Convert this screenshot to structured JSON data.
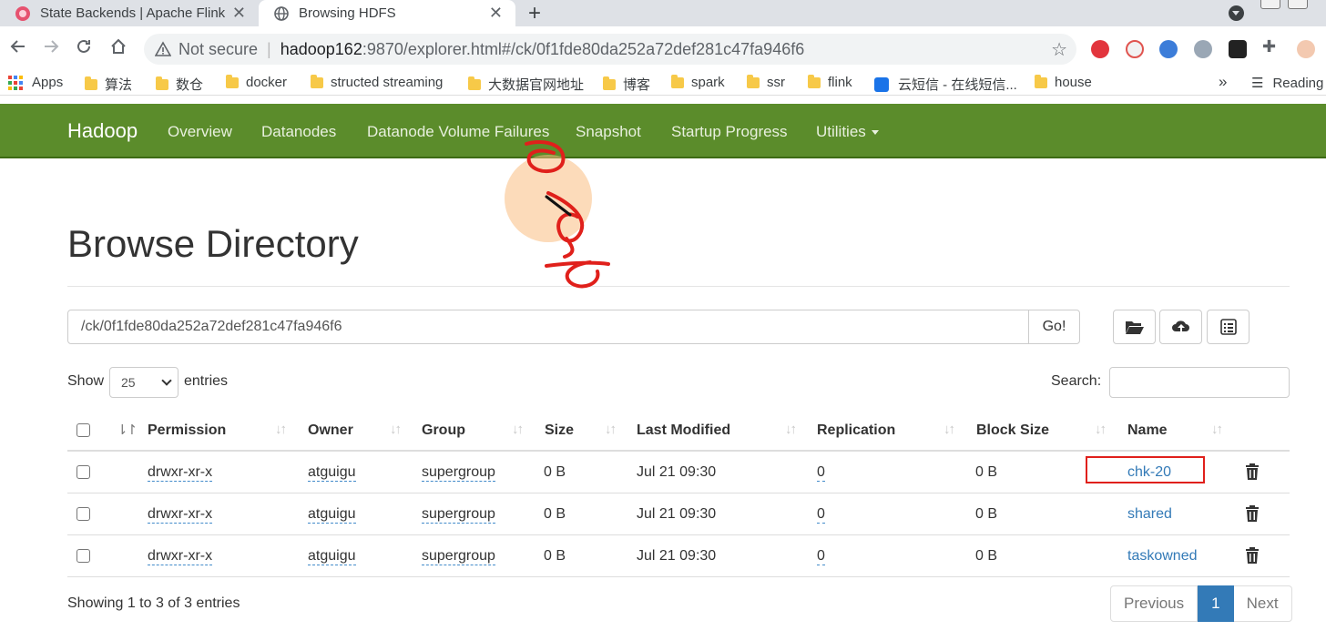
{
  "browser": {
    "tabs": [
      {
        "title": "State Backends | Apache Flink",
        "active": false
      },
      {
        "title": "Browsing HDFS",
        "active": true
      }
    ],
    "new_tab": "+",
    "close_glyph": "✕",
    "address": {
      "security": "Not secure",
      "host": "hadoop162",
      "path": ":9870/explorer.html#/ck/0f1fde80da252a72def281c47fa946f6"
    },
    "bookmarks": [
      {
        "label": "Apps",
        "icon": "apps-grid-icon"
      },
      {
        "label": "算法",
        "icon": "folder-icon"
      },
      {
        "label": "数仓",
        "icon": "folder-icon"
      },
      {
        "label": "docker",
        "icon": "folder-icon"
      },
      {
        "label": "structed streaming",
        "icon": "folder-icon"
      },
      {
        "label": "大数据官网地址",
        "icon": "folder-icon"
      },
      {
        "label": "博客",
        "icon": "folder-icon"
      },
      {
        "label": "spark",
        "icon": "folder-icon"
      },
      {
        "label": "ssr",
        "icon": "folder-icon"
      },
      {
        "label": "flink",
        "icon": "folder-icon"
      },
      {
        "label": "云短信 - 在线短信...",
        "icon": "cloud-sms-icon"
      },
      {
        "label": "house",
        "icon": "folder-icon"
      }
    ],
    "more_bookmarks": "»",
    "reading_list": "Reading"
  },
  "navbar": {
    "brand": "Hadoop",
    "links": [
      "Overview",
      "Datanodes",
      "Datanode Volume Failures",
      "Snapshot",
      "Startup Progress",
      "Utilities"
    ],
    "color": "#5b8c2b"
  },
  "page": {
    "title": "Browse Directory",
    "path_value": "/ck/0f1fde80da252a72def281c47fa946f6",
    "go_label": "Go!",
    "show_label": "Show",
    "entries_value": "25",
    "entries_label": "entries",
    "search_label": "Search:",
    "columns": [
      "Permission",
      "Owner",
      "Group",
      "Size",
      "Last Modified",
      "Replication",
      "Block Size",
      "Name"
    ],
    "rows": [
      {
        "permission": "drwxr-xr-x",
        "owner": "atguigu",
        "group": "supergroup",
        "size": "0 B",
        "modified": "Jul 21 09:30",
        "replication": "0",
        "block_size": "0 B",
        "name": "chk-20"
      },
      {
        "permission": "drwxr-xr-x",
        "owner": "atguigu",
        "group": "supergroup",
        "size": "0 B",
        "modified": "Jul 21 09:30",
        "replication": "0",
        "block_size": "0 B",
        "name": "shared"
      },
      {
        "permission": "drwxr-xr-x",
        "owner": "atguigu",
        "group": "supergroup",
        "size": "0 B",
        "modified": "Jul 21 09:30",
        "replication": "0",
        "block_size": "0 B",
        "name": "taskowned"
      }
    ],
    "showing_text": "Showing 1 to 3 of 3 entries",
    "pager": {
      "previous": "Previous",
      "current": "1",
      "next": "Next"
    },
    "link_color": "#337ab7",
    "highlight_color": "#e0201b"
  }
}
